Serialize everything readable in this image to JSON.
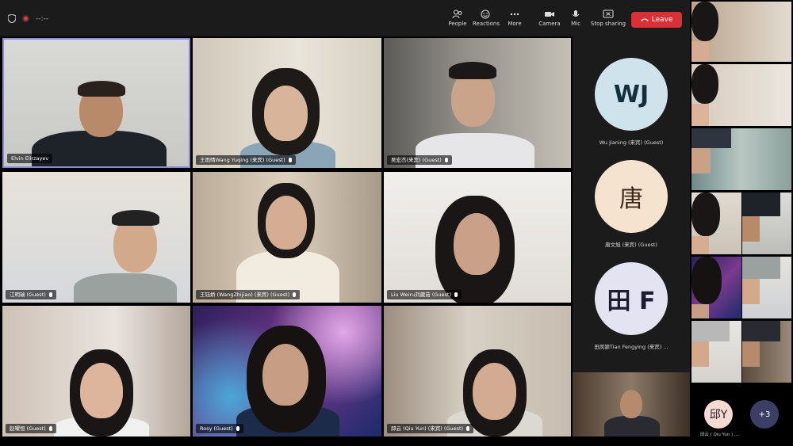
{
  "topbar": {
    "status_text": "--:--",
    "buttons": [
      {
        "label": "People",
        "icon": "people-icon"
      },
      {
        "label": "Reactions",
        "icon": "reactions-icon"
      },
      {
        "label": "More",
        "icon": "more-icon"
      },
      {
        "label": "Camera",
        "icon": "camera-icon"
      },
      {
        "label": "Mic",
        "icon": "mic-icon"
      },
      {
        "label": "Stop sharing",
        "icon": "stop-sharing-icon"
      }
    ],
    "leave_label": "Leave"
  },
  "tiles": [
    {
      "name": "Elvin Elirzayev",
      "active_speaker": true
    },
    {
      "name": "王雨晴Wang Yuqing (来宾) (Guest)"
    },
    {
      "name": "吴宏杰(来宾) (Guest)"
    },
    {
      "name": "江明瑞 (Guest)"
    },
    {
      "name": "王钰娇 (WangZhijiao) (来宾) (Guest)"
    },
    {
      "name": "Liu Weiru刘葳茹 (Guest)"
    },
    {
      "name": "赵曜恒 (Guest)"
    },
    {
      "name": "Rosy (Guest)"
    },
    {
      "name": "邱云 (Qiu Yun) (来宾) (Guest)"
    }
  ],
  "side": {
    "avatars": [
      {
        "initials": "WJ",
        "name": "Wu Jianing (来宾) (Guest)",
        "color": "#cfe3ec",
        "text_color": "#12313d"
      },
      {
        "initials": "唐",
        "name": "唐文旭 (来宾) (Guest)",
        "color": "#f6e3cf",
        "text_color": "#3a2a1a"
      },
      {
        "initials": "田 F",
        "name": "田凤颖Tian Fengying (来宾) ...",
        "color": "#e3e3f1",
        "text_color": "#1c1c2e"
      }
    ]
  },
  "right_panel": {
    "bottom_avatar_initials": "邱Y",
    "bottom_avatar_label": "邱云 ( Qiu Yun ) ...",
    "more_count": "+3"
  },
  "colors": {
    "accent_active": "#8a8ad8",
    "leave": "#d93236",
    "topbar": "#1b1b1b"
  }
}
